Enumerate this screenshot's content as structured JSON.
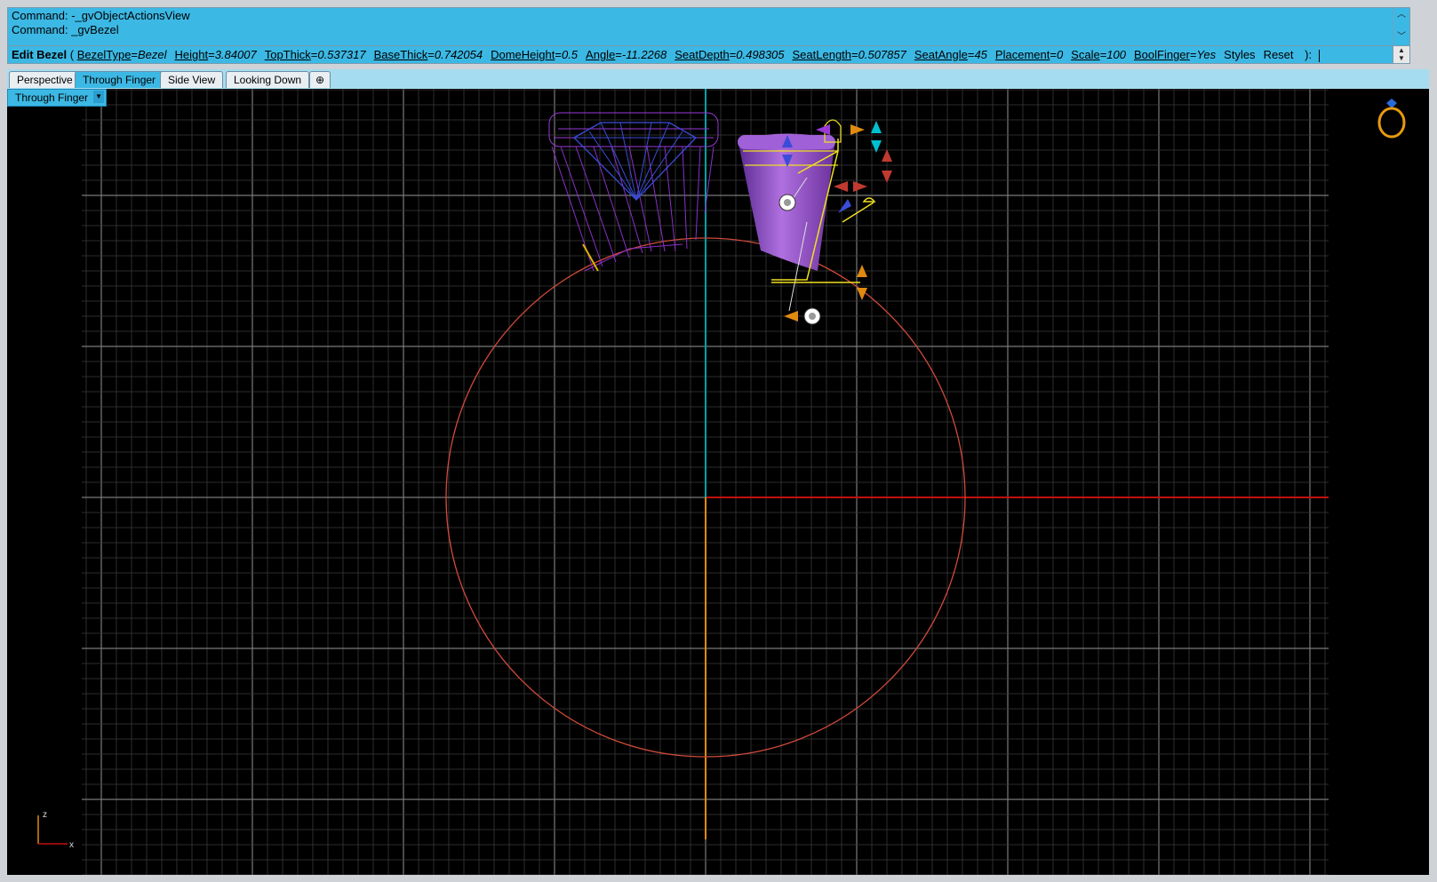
{
  "command_history": {
    "lines": [
      "Command: -_gvObjectActionsView",
      "Command: _gvBezel"
    ]
  },
  "prompt": {
    "title": "Edit Bezel",
    "open": "(",
    "options": [
      {
        "key": "BezelType",
        "value": "Bezel"
      },
      {
        "key": "Height",
        "value": "3.84007"
      },
      {
        "key": "TopThick",
        "value": "0.537317"
      },
      {
        "key": "BaseThick",
        "value": "0.742054"
      },
      {
        "key": "DomeHeight",
        "value": "0.5"
      },
      {
        "key": "Angle",
        "value": "-11.2268"
      },
      {
        "key": "SeatDepth",
        "value": "0.498305"
      },
      {
        "key": "SeatLength",
        "value": "0.507857"
      },
      {
        "key": "SeatAngle",
        "value": "45"
      },
      {
        "key": "Placement",
        "value": "0"
      },
      {
        "key": "Scale",
        "value": "100"
      },
      {
        "key": "BoolFinger",
        "value": "Yes"
      }
    ],
    "actions": [
      "Styles",
      "Reset"
    ],
    "close": "):"
  },
  "tabs": [
    {
      "label": "Perspective",
      "active": false
    },
    {
      "label": "Through Finger",
      "active": true
    },
    {
      "label": "Side View",
      "active": false
    },
    {
      "label": "Looking Down",
      "active": false
    }
  ],
  "add_tab_glyph": "⊕",
  "viewport": {
    "title": "Through Finger",
    "axis": {
      "z": "z",
      "x": "x"
    }
  },
  "colors": {
    "accent": "#3cb8e4",
    "grid": "#3a3a3a",
    "grid_major": "#7a7a7a",
    "x_axis": "#c0100f",
    "y_axis": "#00a0a8",
    "z_axis": "#e08a10",
    "finger": "#d04a3a",
    "gem": "#3a4cd8",
    "bezel": "#8a40c8",
    "selection": "#f0e020"
  }
}
